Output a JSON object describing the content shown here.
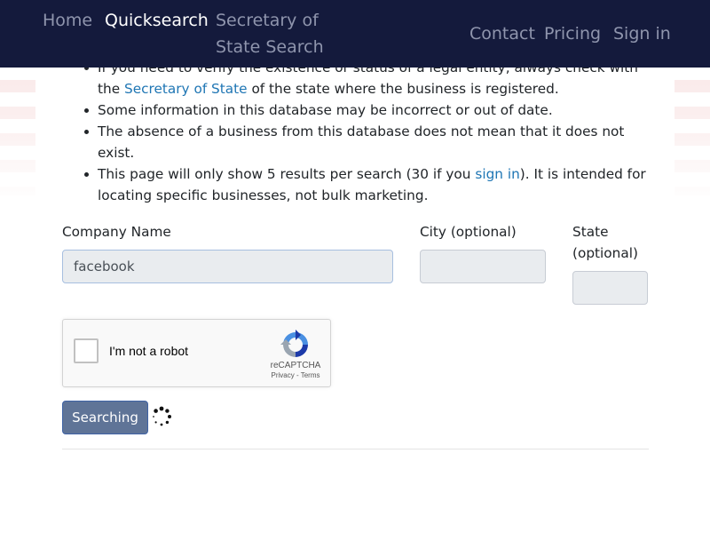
{
  "nav": {
    "home": "Home",
    "quicksearch": "Quicksearch",
    "sos_search": "Secretary of State Search",
    "contact": "Contact",
    "pricing": "Pricing",
    "signin": "Sign in"
  },
  "notes": {
    "item1_prefix": "If you need to verify the existence or status of a legal entity, always check with the",
    "item1_link": "Secretary of State",
    "item1_suffix": "of the state where the business is registered.",
    "item2": "Some information in this database may be incorrect or out of date.",
    "item3": "The absence of a business from this database does not mean that it does not exist.",
    "item4_prefix": "This page will only show 5 results per search (30 if you",
    "item4_link": "sign in",
    "item4_suffix": "). It is intended for locating specific businesses, not bulk marketing."
  },
  "form": {
    "company_label": "Company Name",
    "company_value": "facebook",
    "city_label": "City (optional)",
    "city_value": "",
    "state_label": "State (optional)",
    "state_value": ""
  },
  "captcha": {
    "label": "I'm not a robot",
    "brand": "reCAPTCHA",
    "links": "Privacy - Terms"
  },
  "search_button": {
    "label": "Searching"
  },
  "colors": {
    "navbar": "#141a3c",
    "link": "#1f76b4",
    "button": "#5f7497",
    "input_bg": "#e9ecef"
  },
  "icons": {
    "spinner": "loading-spinner-icon",
    "recaptcha": "recaptcha-logo-icon"
  }
}
